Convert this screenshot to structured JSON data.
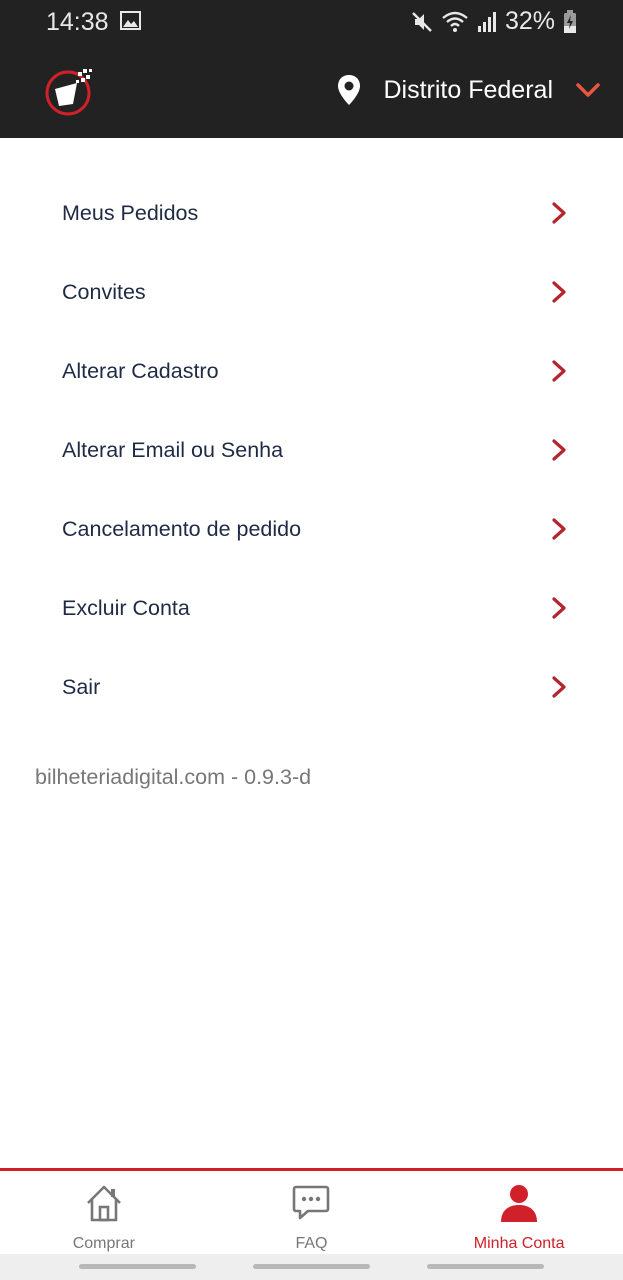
{
  "status_bar": {
    "time": "14:38",
    "battery": "32%",
    "icons": [
      "gallery-icon",
      "mute-icon",
      "wifi-icon",
      "signal-icon",
      "battery-charging-icon"
    ]
  },
  "header": {
    "location": "Distrito Federal",
    "accent_color": "#e8573f"
  },
  "menu": {
    "items": [
      {
        "label": "Meus Pedidos"
      },
      {
        "label": "Convites"
      },
      {
        "label": "Alterar Cadastro"
      },
      {
        "label": "Alterar Email ou Senha"
      },
      {
        "label": "Cancelamento de pedido"
      },
      {
        "label": "Excluir Conta"
      },
      {
        "label": "Sair"
      }
    ],
    "chevron_color": "#b3262d"
  },
  "version": "bilheteriadigital.com - 0.9.3-d",
  "tabbar": {
    "tabs": [
      {
        "label": "Comprar",
        "icon": "home-icon",
        "active": false
      },
      {
        "label": "FAQ",
        "icon": "chat-icon",
        "active": false
      },
      {
        "label": "Minha Conta",
        "icon": "person-icon",
        "active": true
      }
    ],
    "active_color": "#d0202a"
  }
}
